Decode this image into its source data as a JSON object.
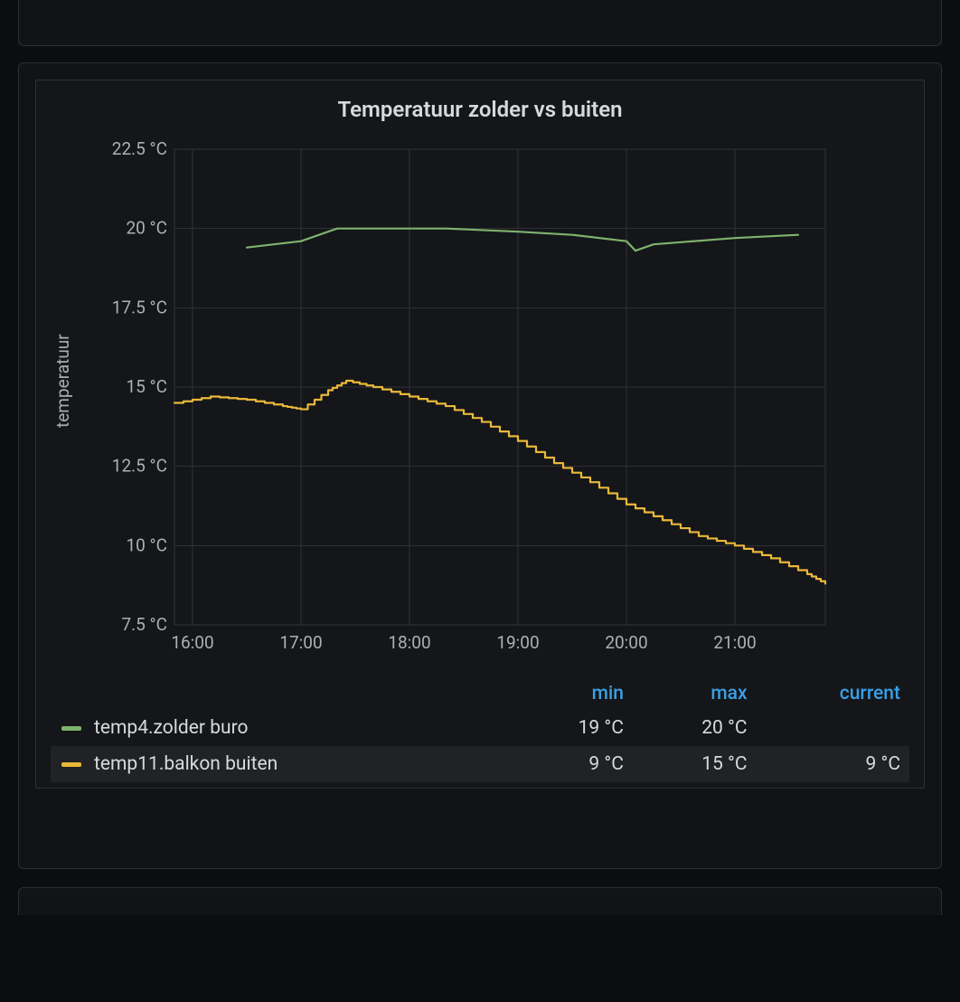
{
  "panel": {
    "title": "Temperatuur zolder vs buiten",
    "y_axis_title": "temperatuur"
  },
  "legend_headers": {
    "min": "min",
    "max": "max",
    "current": "current"
  },
  "legend_rows": [
    {
      "name": "temp4.zolder buro",
      "color": "#7eb26d",
      "min": "19 °C",
      "max": "20 °C",
      "current": ""
    },
    {
      "name": "temp11.balkon buiten",
      "color": "#eab839",
      "min": "9 °C",
      "max": "15 °C",
      "current": "9 °C"
    }
  ],
  "chart_data": {
    "type": "line",
    "title": "Temperatuur zolder vs buiten",
    "xlabel": "",
    "ylabel": "temperatuur",
    "y_unit": "°C",
    "x_type": "time",
    "x_ticks": [
      "16:00",
      "17:00",
      "18:00",
      "19:00",
      "20:00",
      "21:00"
    ],
    "y_ticks": [
      7.5,
      10,
      12.5,
      15,
      17.5,
      20,
      22.5
    ],
    "xlim_minutes": [
      950,
      1310
    ],
    "ylim": [
      7.5,
      22.5
    ],
    "series": [
      {
        "name": "temp4.zolder buro",
        "color": "#7eb26d",
        "x_minutes": [
          990,
          1020,
          1040,
          1060,
          1080,
          1100,
          1140,
          1170,
          1200,
          1205,
          1215,
          1260,
          1295
        ],
        "values": [
          19.4,
          19.6,
          20.0,
          20.0,
          20.0,
          20.0,
          19.9,
          19.8,
          19.6,
          19.3,
          19.5,
          19.7,
          19.8
        ]
      },
      {
        "name": "temp11.balkon buiten",
        "color": "#eab839",
        "x_minutes": [
          950,
          970,
          990,
          1010,
          1020,
          1035,
          1045,
          1060,
          1080,
          1100,
          1120,
          1140,
          1160,
          1180,
          1200,
          1220,
          1240,
          1260,
          1280,
          1300,
          1310
        ],
        "values": [
          14.5,
          14.7,
          14.6,
          14.4,
          14.3,
          14.9,
          15.2,
          15.0,
          14.7,
          14.4,
          13.9,
          13.3,
          12.6,
          12.0,
          11.3,
          10.8,
          10.3,
          10.0,
          9.6,
          9.1,
          8.8
        ]
      }
    ]
  }
}
